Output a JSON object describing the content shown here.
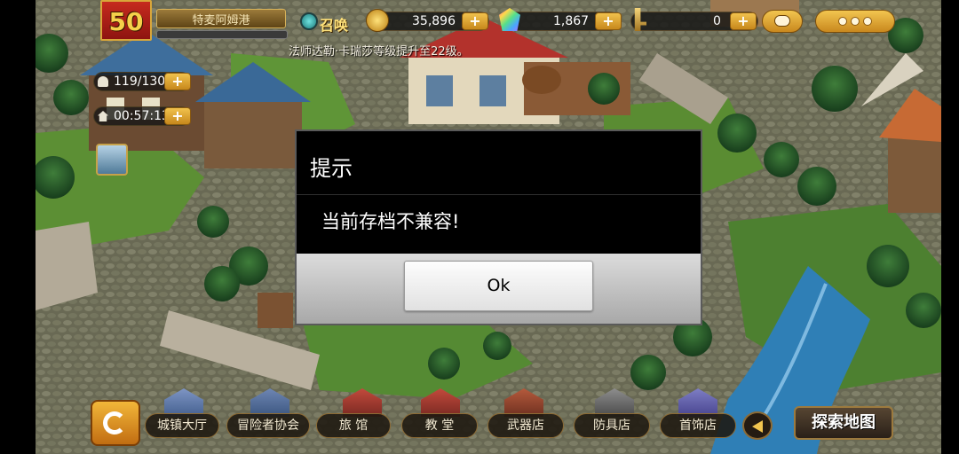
{
  "hud": {
    "level": "50",
    "player_name": "特麦阿姆港",
    "summon_label": "召唤",
    "gold": "35,896",
    "gems": "1,867",
    "keys": "0",
    "plus": "+"
  },
  "notice": "法师达勒·卡瑞莎等级提升至22级。",
  "side": {
    "population": "119/130",
    "timer": "00:57:13"
  },
  "dialog": {
    "title": "提示",
    "message": "当前存档不兼容!",
    "ok_label": "Ok"
  },
  "bottom_nav": {
    "items": [
      {
        "label": "城镇大厅"
      },
      {
        "label": "冒险者协会"
      },
      {
        "label": "旅 馆"
      },
      {
        "label": "教 堂"
      },
      {
        "label": "武器店"
      },
      {
        "label": "防具店"
      },
      {
        "label": "首饰店"
      }
    ],
    "explore_label": "探索地图"
  },
  "icons": {
    "summon": "summon-gear-icon",
    "gold": "gold-coin-icon",
    "gem": "gem-icon",
    "key": "key-icon",
    "chat": "speech-bubble-icon",
    "menu": "more-dots-icon",
    "population": "person-icon",
    "timer": "house-icon",
    "quest": "quest-scroll-icon",
    "home": "refresh-arrows-icon",
    "prev": "left-arrow-icon"
  },
  "colors": {
    "dialog_bg": "#000000",
    "ok_button_bg": "#f4f4f4",
    "gold_button": "#e3a93a",
    "level_flag": "#b01e14"
  }
}
